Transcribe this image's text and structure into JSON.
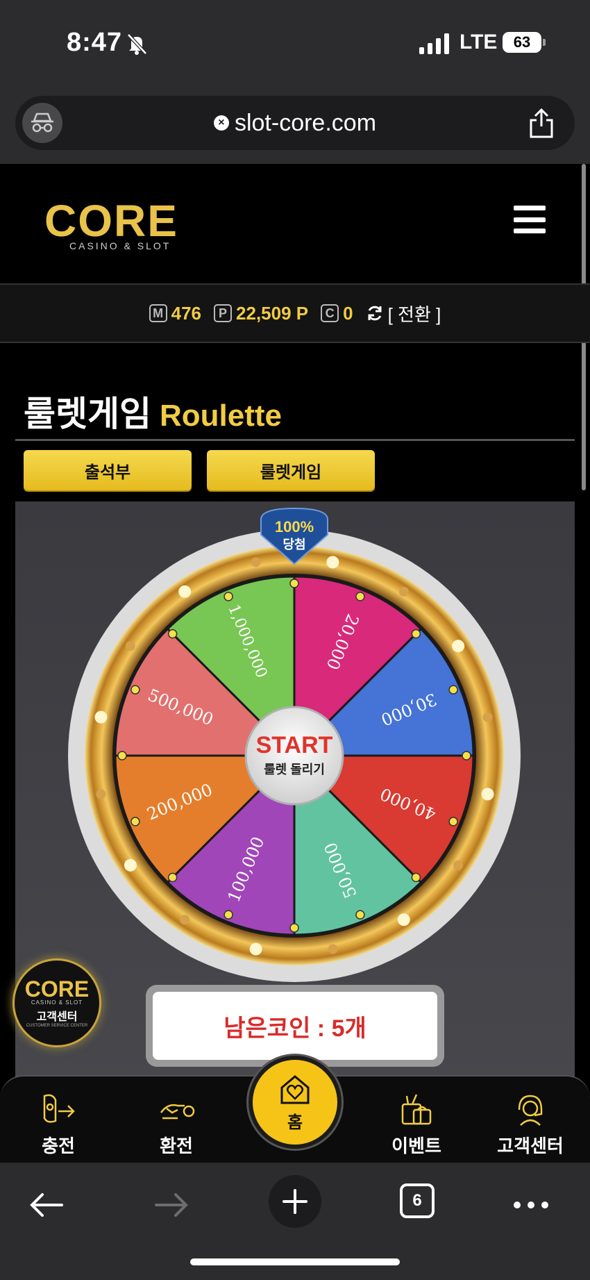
{
  "status_bar": {
    "time": "8:47",
    "network": "LTE",
    "battery": "63"
  },
  "browser": {
    "url": "slot-core.com",
    "tab_count": "6"
  },
  "site": {
    "logo_text": "CORE",
    "logo_sub": "CASINO & SLOT"
  },
  "points": {
    "m_icon": "M",
    "m_value": "476",
    "p_icon": "P",
    "p_value": "22,509 P",
    "c_icon": "C",
    "c_value": "0",
    "switch_label": "[ 전환 ]"
  },
  "page": {
    "title_ko": "룰렛게임",
    "title_en": "Roulette"
  },
  "tabs": [
    {
      "label": "출석부"
    },
    {
      "label": "룰렛게임"
    }
  ],
  "roulette": {
    "badge_top": "100%",
    "badge_bottom": "당첨",
    "start_label": "START",
    "start_sub": "룰렛 돌리기",
    "segments": [
      {
        "value": "20,000",
        "color": "#d8297a"
      },
      {
        "value": "30,000",
        "color": "#4573d6"
      },
      {
        "value": "40,000",
        "color": "#d93a31"
      },
      {
        "value": "50,000",
        "color": "#62c3a0"
      },
      {
        "value": "100,000",
        "color": "#a046b8"
      },
      {
        "value": "200,000",
        "color": "#e57e2c"
      },
      {
        "value": "500,000",
        "color": "#e2706e"
      },
      {
        "value": "1,000,000",
        "color": "#78c653"
      }
    ]
  },
  "coins": {
    "label": "남은코인 : 5개"
  },
  "floating_cs": {
    "logo": "CORE",
    "sub": "CASINO & SLOT",
    "label": "고객센터",
    "sub2": "CUSTOMER SERVICE CENTER"
  },
  "nav": {
    "charge": "충전",
    "exchange": "환전",
    "home": "홈",
    "event": "이벤트",
    "support": "고객센터"
  },
  "colors": {
    "accent_gold": "#f1cc43",
    "coin_red": "#d92b2b",
    "home_yellow": "#f5c417"
  }
}
